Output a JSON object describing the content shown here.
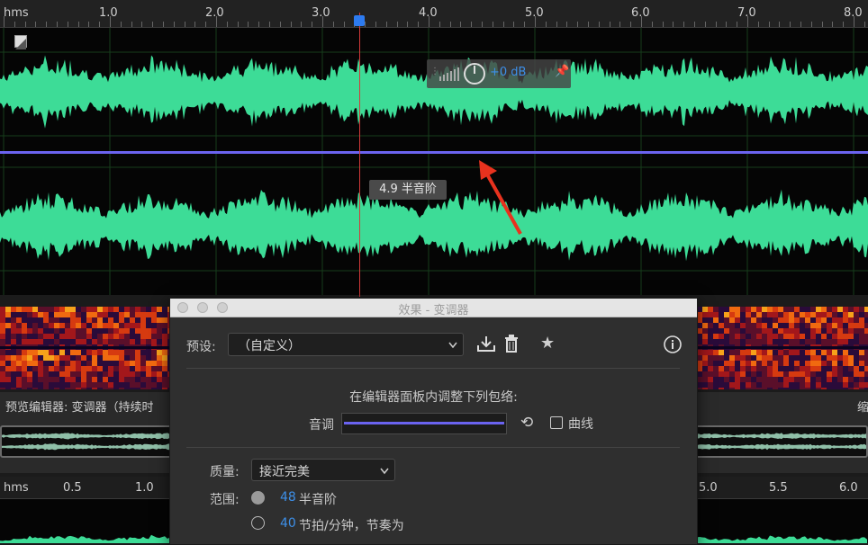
{
  "ruler_top": {
    "unit_label": "hms",
    "ticks": [
      "1.0",
      "2.0",
      "3.0",
      "4.0",
      "5.0",
      "6.0",
      "7.0",
      "8.0"
    ]
  },
  "hud": {
    "gain": "+0 dB"
  },
  "pitch_badge": "4.9 半音阶",
  "preview": {
    "left_label": "预览编辑器: 变调器（持续时",
    "right_label": "缩"
  },
  "ruler_bottom": {
    "unit_label": "hms",
    "ticks_left": [
      "0.5",
      "1.0"
    ],
    "ticks_right": [
      "5.0",
      "5.5",
      "6.0"
    ]
  },
  "dialog": {
    "title": "效果 - 变调器",
    "preset_label": "预设:",
    "preset_value": "（自定义）",
    "instruction": "在编辑器面板内调整下列包络:",
    "pitch_label": "音调",
    "curve_label": "曲线",
    "quality_label": "质量:",
    "quality_value": "接近完美",
    "range_label": "范围:",
    "range_option1_value": "48",
    "range_option1_unit": "半音阶",
    "range_option2_value": "40",
    "range_option2_unit": "节拍/分钟，节奏为"
  },
  "colors": {
    "waveform": "#3ddc97",
    "envelope": "#6b63f0",
    "playhead": "#d43a3a",
    "accent": "#3d8fe8",
    "annotation_arrow": "#e8321e"
  }
}
